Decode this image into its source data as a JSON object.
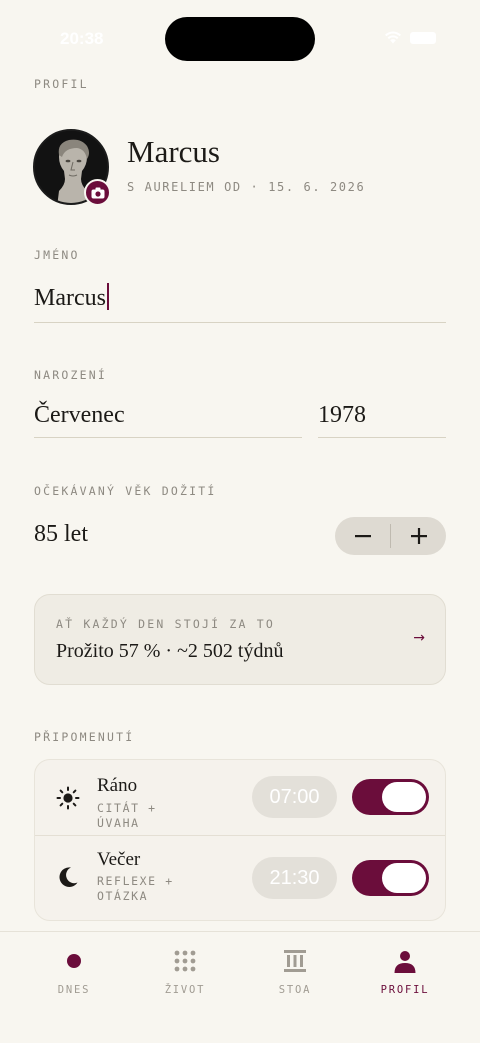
{
  "status_bar": {
    "time": "20:38"
  },
  "header": {
    "section_label": "PROFIL"
  },
  "profile": {
    "name": "Marcus",
    "since": "S AURELIEM OD · 15. 6. 2026"
  },
  "name_field": {
    "label": "JMÉNO",
    "value": "Marcus"
  },
  "birth": {
    "label": "NAROZENÍ",
    "month": "Červenec",
    "year": "1978"
  },
  "life_expectancy": {
    "label": "OČEKÁVANÝ VĚK DOŽITÍ",
    "value": "85 let",
    "minus": "−",
    "plus": "+"
  },
  "card": {
    "label": "AŤ KAŽDÝ DEN STOJÍ ZA TO",
    "value": "Prožito 57 % · ~2 502 týdnů",
    "arrow": "→"
  },
  "reminders": {
    "label": "PŘIPOMENUTÍ",
    "items": [
      {
        "title": "Ráno",
        "subtitle": "CITÁT + ÚVAHA",
        "time": "07:00",
        "icon": "sun-icon",
        "enabled": true
      },
      {
        "title": "Večer",
        "subtitle": "REFLEXE + OTÁZKA",
        "time": "21:30",
        "icon": "moon-icon",
        "enabled": true
      }
    ]
  },
  "tabbar": {
    "tabs": [
      {
        "label": "DNES",
        "icon": "dot-icon",
        "active": false
      },
      {
        "label": "ŽIVOT",
        "icon": "grid-icon",
        "active": false
      },
      {
        "label": "STOA",
        "icon": "column-icon",
        "active": false
      },
      {
        "label": "PROFIL",
        "icon": "person-icon",
        "active": true
      }
    ]
  },
  "colors": {
    "accent": "#6b0d3b",
    "background": "#f8f6f0",
    "muted": "#8e8a82",
    "card": "#efece4"
  }
}
